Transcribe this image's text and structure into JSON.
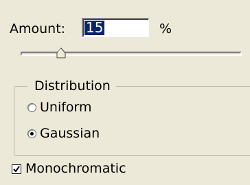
{
  "amount": {
    "label": "Amount:",
    "value": "15",
    "unit": "%"
  },
  "slider": {
    "value_fraction": 0.15
  },
  "distribution": {
    "legend": "Distribution",
    "options": [
      {
        "label": "Uniform",
        "selected": false
      },
      {
        "label": "Gaussian",
        "selected": true
      }
    ]
  },
  "monochromatic": {
    "label": "Monochromatic",
    "checked": true
  }
}
